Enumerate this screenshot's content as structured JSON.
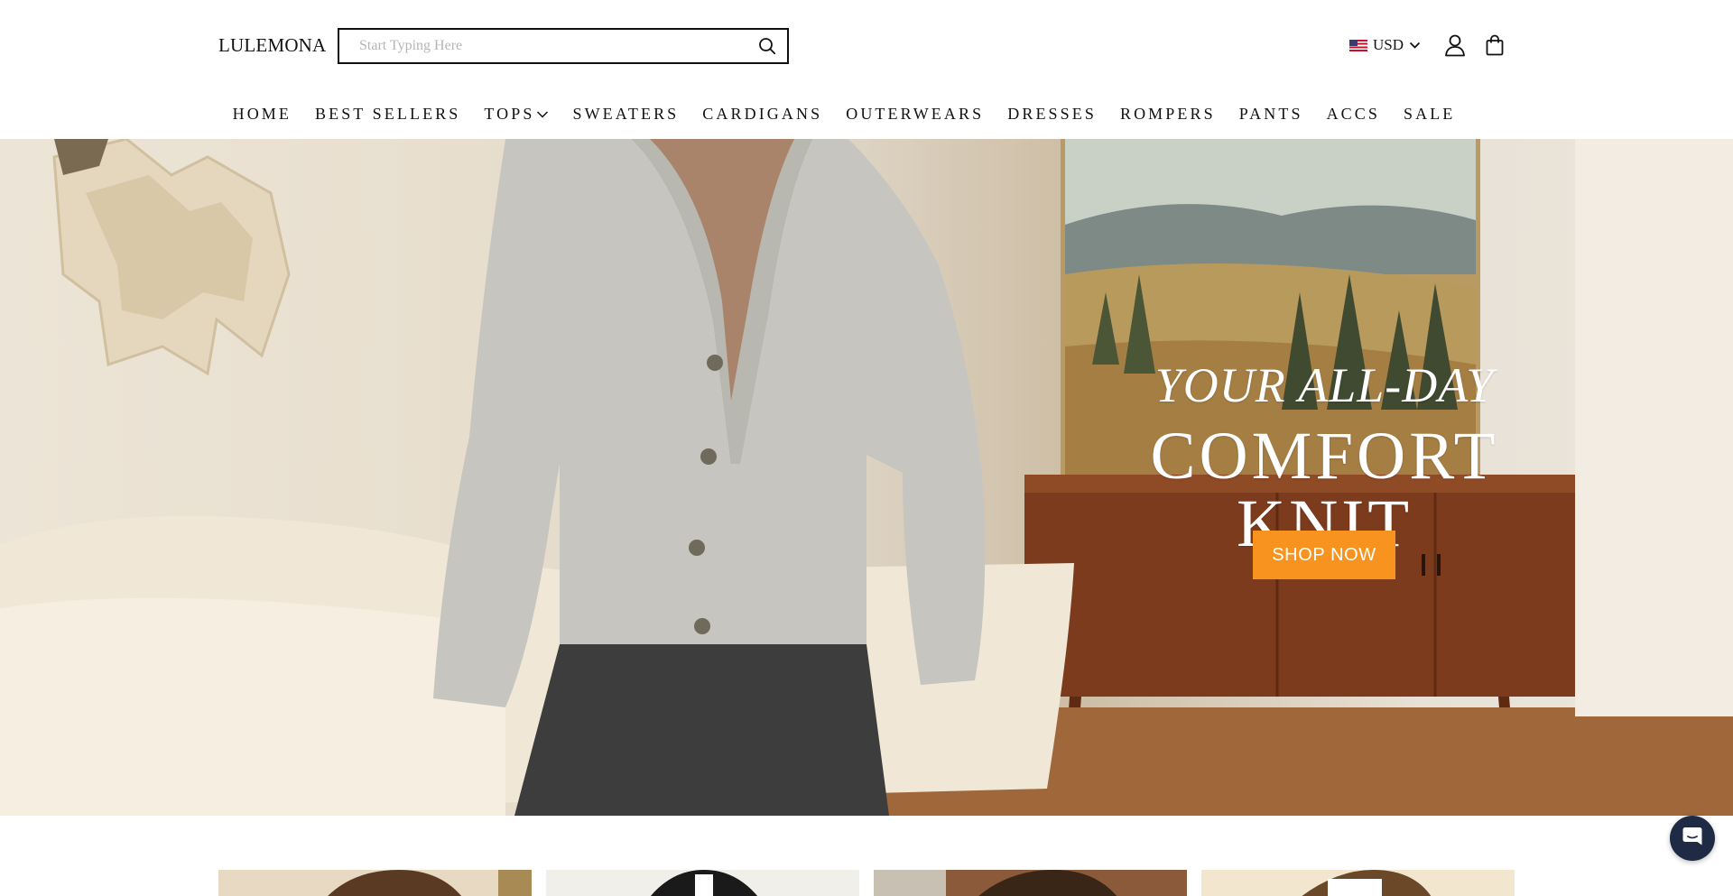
{
  "brand": {
    "name": "LULEMONA"
  },
  "search": {
    "placeholder": "Start Typing Here",
    "value": "",
    "icon": "search-icon"
  },
  "currency": {
    "code": "USD",
    "flag": "us-flag-icon"
  },
  "header_icons": {
    "account": "user-icon",
    "cart": "shopping-bag-icon"
  },
  "nav": {
    "items": [
      {
        "label": "HOME"
      },
      {
        "label": "BEST SELLERS"
      },
      {
        "label": "TOPS",
        "has_dropdown": true
      },
      {
        "label": "SWEATERS"
      },
      {
        "label": "CARDIGANS"
      },
      {
        "label": "OUTERWEARS"
      },
      {
        "label": "DRESSES"
      },
      {
        "label": "ROMPERS"
      },
      {
        "label": "PANTS"
      },
      {
        "label": "ACCS"
      },
      {
        "label": "SALE"
      }
    ]
  },
  "hero": {
    "subtitle": "YOUR ALL-DAY",
    "title": "COMFORT KNIT",
    "cta_label": "SHOP NOW",
    "cta_color": "#f7931e"
  },
  "chat": {
    "icon": "chat-bubble-icon",
    "color": "#1f2a44"
  }
}
